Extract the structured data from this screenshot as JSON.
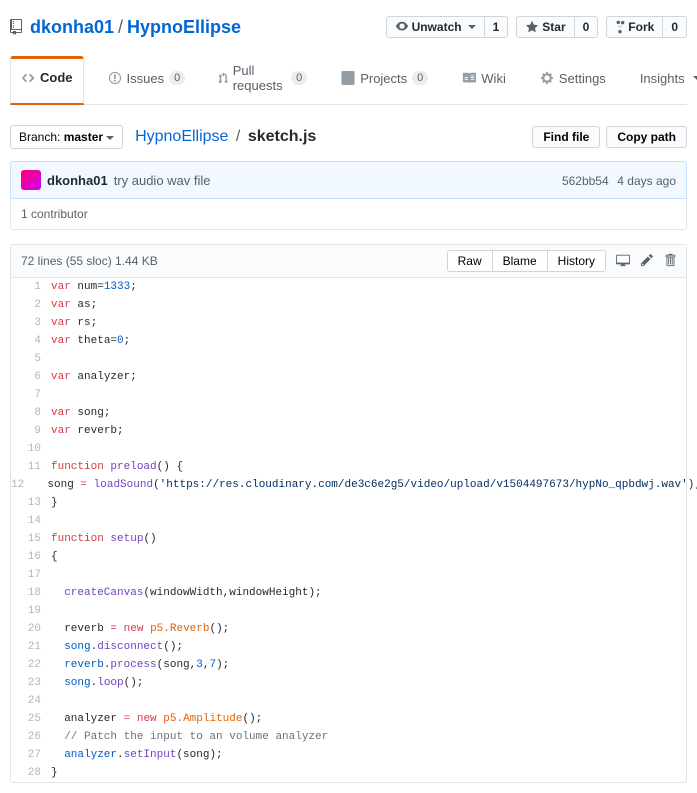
{
  "repo": {
    "owner": "dkonha01",
    "name": "HypnoEllipse"
  },
  "watch": {
    "label": "Unwatch",
    "count": "1"
  },
  "star": {
    "label": "Star",
    "count": "0"
  },
  "fork": {
    "label": "Fork",
    "count": "0"
  },
  "nav": {
    "code": "Code",
    "issues": "Issues",
    "issues_count": "0",
    "pulls": "Pull requests",
    "pulls_count": "0",
    "projects": "Projects",
    "projects_count": "0",
    "wiki": "Wiki",
    "settings": "Settings",
    "insights": "Insights"
  },
  "branch": {
    "prefix": "Branch:",
    "name": "master"
  },
  "breadcrumb": {
    "root": "HypnoEllipse",
    "file": "sketch.js"
  },
  "buttons": {
    "find": "Find file",
    "copy": "Copy path",
    "raw": "Raw",
    "blame": "Blame",
    "history": "History"
  },
  "commit": {
    "author": "dkonha01",
    "message": "try audio wav file",
    "sha": "562bb54",
    "ago": "4 days ago"
  },
  "contributors": "1 contributor",
  "file_info": "72 lines (55 sloc)  1.44 KB",
  "code": [
    {
      "n": "1",
      "h": "<span class='k'>var</span> num=<span class='n'>1333</span>;"
    },
    {
      "n": "2",
      "h": "<span class='k'>var</span> as;"
    },
    {
      "n": "3",
      "h": "<span class='k'>var</span> rs;"
    },
    {
      "n": "4",
      "h": "<span class='k'>var</span> theta=<span class='n'>0</span>;"
    },
    {
      "n": "5",
      "h": ""
    },
    {
      "n": "6",
      "h": "<span class='k'>var</span> analyzer;"
    },
    {
      "n": "7",
      "h": ""
    },
    {
      "n": "8",
      "h": "<span class='k'>var</span> song;"
    },
    {
      "n": "9",
      "h": "<span class='k'>var</span> reverb;"
    },
    {
      "n": "10",
      "h": ""
    },
    {
      "n": "11",
      "h": "<span class='k'>function</span> <span class='fn'>preload</span>() {"
    },
    {
      "n": "12",
      "h": "  song <span class='k'>=</span> <span class='fn'>loadSound</span>(<span class='s'>'https://res.cloudinary.com/de3c6e2g5/video/upload/v1504497673/hypNo_qpbdwj.wav'</span>);"
    },
    {
      "n": "13",
      "h": "}"
    },
    {
      "n": "14",
      "h": ""
    },
    {
      "n": "15",
      "h": "<span class='k'>function</span> <span class='fn'>setup</span>()"
    },
    {
      "n": "16",
      "h": "{"
    },
    {
      "n": "17",
      "h": ""
    },
    {
      "n": "18",
      "h": "  <span class='fn'>createCanvas</span>(windowWidth,windowHeight);"
    },
    {
      "n": "19",
      "h": ""
    },
    {
      "n": "20",
      "h": "  reverb <span class='k'>=</span> <span class='k'>new</span> <span class='nw'>p5.Reverb</span>();"
    },
    {
      "n": "21",
      "h": "  <span class='n'>song</span>.<span class='fn'>disconnect</span>();"
    },
    {
      "n": "22",
      "h": "  <span class='n'>reverb</span>.<span class='fn'>process</span>(song,<span class='n'>3</span>,<span class='n'>7</span>);"
    },
    {
      "n": "23",
      "h": "  <span class='n'>song</span>.<span class='fn'>loop</span>();"
    },
    {
      "n": "24",
      "h": ""
    },
    {
      "n": "25",
      "h": "  analyzer <span class='k'>=</span> <span class='k'>new</span> <span class='nw'>p5.Amplitude</span>();"
    },
    {
      "n": "26",
      "h": "  <span class='c'>// Patch the input to an volume analyzer</span>"
    },
    {
      "n": "27",
      "h": "  <span class='n'>analyzer</span>.<span class='fn'>setInput</span>(song);"
    },
    {
      "n": "28",
      "h": "}"
    }
  ]
}
